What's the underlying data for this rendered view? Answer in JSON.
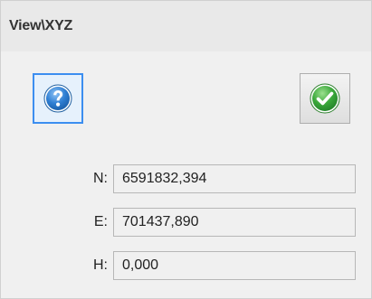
{
  "window": {
    "title": "View\\XYZ"
  },
  "buttons": {
    "help_icon": "question-mark-icon",
    "ok_icon": "checkmark-icon"
  },
  "coordinates": [
    {
      "label": "N:",
      "value": "6591832,394"
    },
    {
      "label": "E:",
      "value": "701437,890"
    },
    {
      "label": "H:",
      "value": "0,000"
    }
  ],
  "colors": {
    "accent_blue": "#3c8ef0",
    "ok_green": "#3aa83a",
    "panel_background": "#f0f0f0"
  }
}
